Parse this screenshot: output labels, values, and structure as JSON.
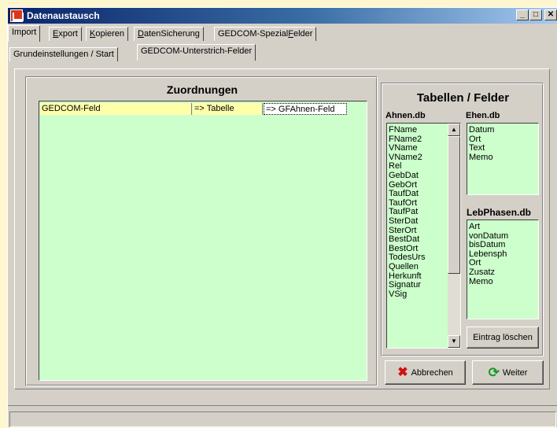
{
  "window": {
    "title": "Datenaustausch",
    "controls": {
      "minimize": "_",
      "maximize": "□",
      "close": "✕"
    }
  },
  "main_tabs": [
    {
      "label": "Import",
      "accel": ""
    },
    {
      "label": "Export",
      "accel": "E"
    },
    {
      "label": "Kopieren",
      "accel": "K"
    },
    {
      "label": "DatenSicherung",
      "accel": "D"
    },
    {
      "label": "GEDCOM-SpezialFelder",
      "accel": "F"
    }
  ],
  "sub_tabs": [
    {
      "label": "Grundeinstellungen / Start"
    },
    {
      "label": "GEDCOM-Unterstrich-Felder"
    }
  ],
  "zuordnungen": {
    "title": "Zuordnungen",
    "columns": [
      "GEDCOM-Feld",
      "=> Tabelle",
      "=> GFAhnen-Feld"
    ]
  },
  "tabellen": {
    "title": "Tabellen / Felder",
    "ahnen": {
      "label": "Ahnen.db",
      "items": [
        "FName",
        "FName2",
        "VName",
        "VName2",
        "Rel",
        "GebDat",
        "GebOrt",
        "TaufDat",
        "TaufOrt",
        "TaufPat",
        "SterDat",
        "SterOrt",
        "BestDat",
        "BestOrt",
        "TodesUrs",
        "Quellen",
        "Herkunft",
        "Signatur",
        "VSig"
      ]
    },
    "ehen": {
      "label": "Ehen.db",
      "items": [
        "Datum",
        "Ort",
        "Text",
        "Memo"
      ]
    },
    "lebphasen": {
      "label": "LebPhasen.db",
      "items": [
        "Art",
        "vonDatum",
        "bisDatum",
        "Lebensph",
        "Ort",
        "Zusatz",
        "Memo"
      ]
    },
    "delete_button": "Eintrag löschen"
  },
  "buttons": {
    "cancel": "Abbrechen",
    "next": "Weiter"
  },
  "colors": {
    "titlebar_start": "#0a246a",
    "titlebar_end": "#a6caf0",
    "list_bg": "#ccffcc",
    "header_highlight": "#ffffaa",
    "dialog_face": "#d4d0c8"
  }
}
